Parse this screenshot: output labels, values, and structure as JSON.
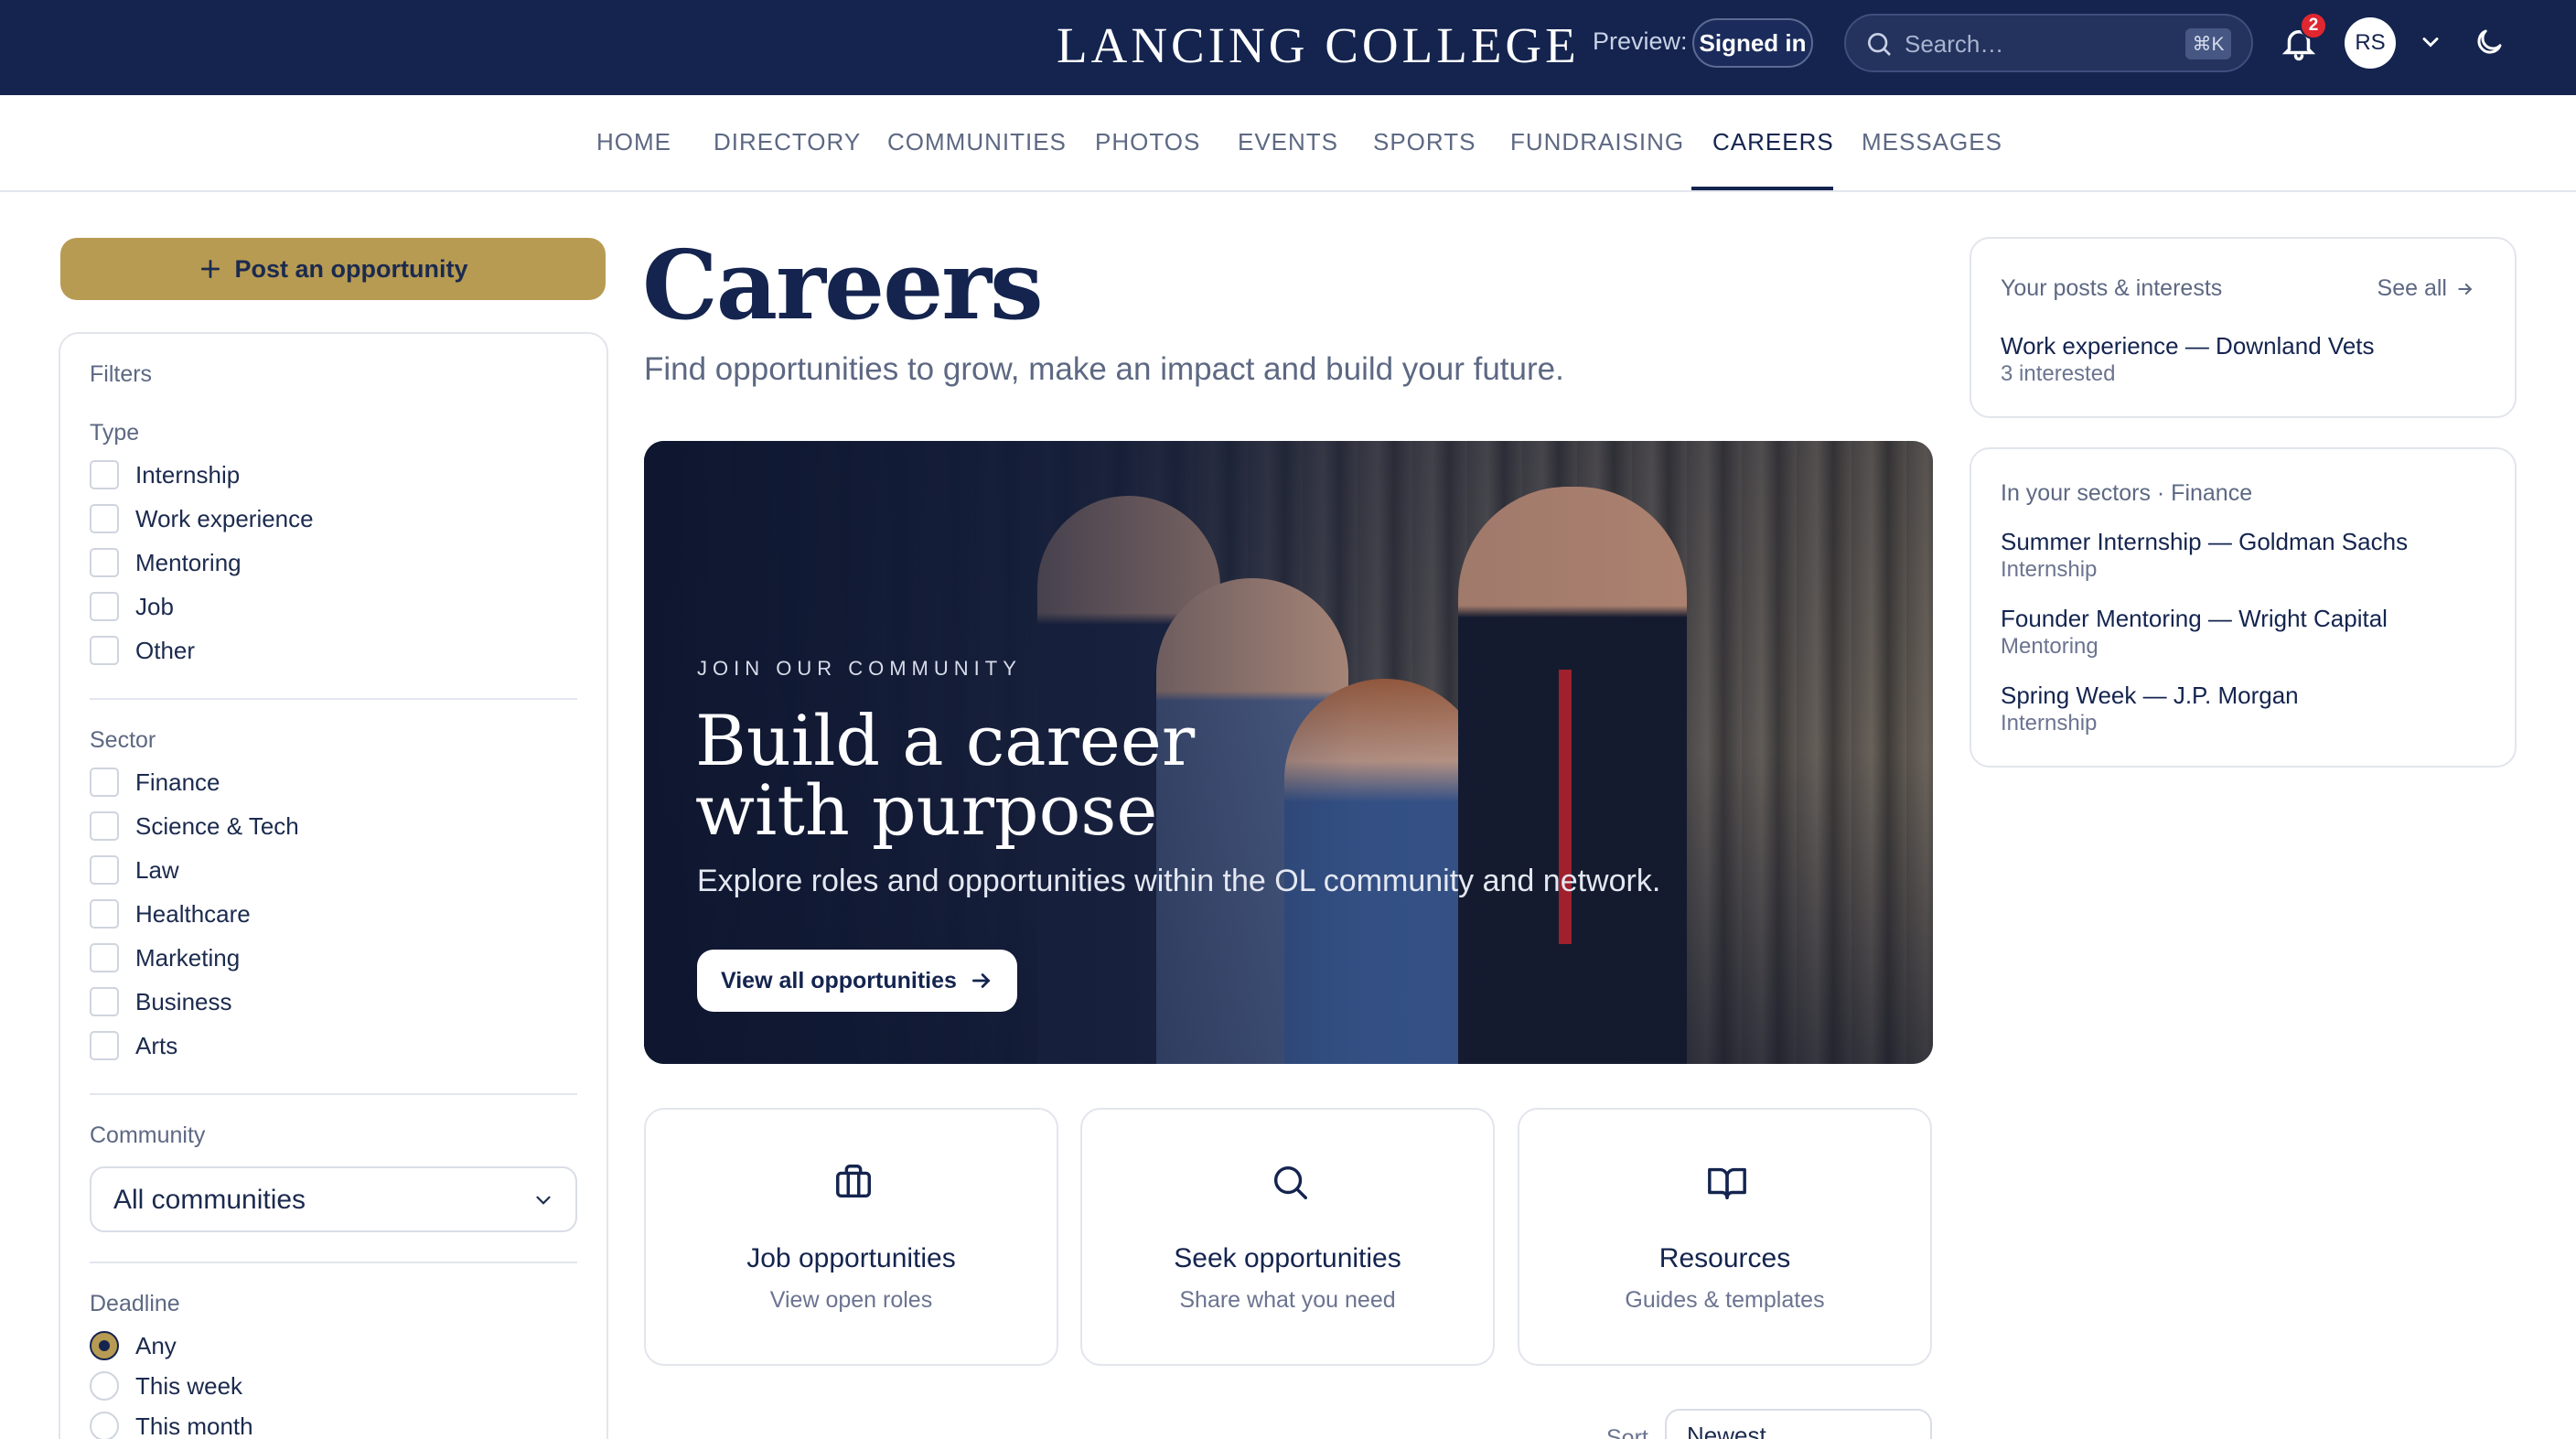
{
  "header": {
    "brand": "LANCING COLLEGE",
    "preview_label": "Preview:",
    "preview_state": "Signed in",
    "search_placeholder": "Search…",
    "search_shortcut": "⌘K",
    "notifications_count": "2",
    "user_initials": "RS",
    "colors": {
      "bar": "#14244f",
      "accent": "#b89b52"
    }
  },
  "nav": {
    "items": [
      "HOME",
      "DIRECTORY",
      "COMMUNITIES",
      "PHOTOS",
      "EVENTS",
      "SPORTS",
      "FUNDRAISING",
      "CAREERS",
      "MESSAGES"
    ],
    "active": "CAREERS"
  },
  "sidebar": {
    "post_button": "Post an opportunity",
    "filters_title": "Filters",
    "type_title": "Type",
    "types": [
      "Internship",
      "Work experience",
      "Mentoring",
      "Job",
      "Other"
    ],
    "sector_title": "Sector",
    "sectors": [
      "Finance",
      "Science & Tech",
      "Law",
      "Healthcare",
      "Marketing",
      "Business",
      "Arts"
    ],
    "community_title": "Community",
    "community_value": "All communities",
    "deadline_title": "Deadline",
    "deadlines": [
      "Any",
      "This week",
      "This month"
    ],
    "deadline_selected": "Any"
  },
  "main": {
    "title": "Careers",
    "subtitle": "Find opportunities to grow, make an impact and build your future.",
    "hero": {
      "kicker": "JOIN OUR COMMUNITY",
      "title_line1": "Build a career",
      "title_line2": "with purpose",
      "description": "Explore roles and opportunities within the OL community and network.",
      "button": "View all opportunities"
    },
    "cards": [
      {
        "title": "Job opportunities",
        "subtitle": "View open roles",
        "icon": "briefcase-icon"
      },
      {
        "title": "Seek opportunities",
        "subtitle": "Share what you need",
        "icon": "search-icon"
      },
      {
        "title": "Resources",
        "subtitle": "Guides & templates",
        "icon": "book-icon"
      }
    ],
    "sort_label": "Sort",
    "sort_value": "Newest"
  },
  "right": {
    "posts_title": "Your posts & interests",
    "see_all": "See all",
    "posts": [
      {
        "title": "Work experience — Downland Vets",
        "meta": "3 interested"
      }
    ],
    "sectors_title": "In your sectors · Finance",
    "sector_items": [
      {
        "title": "Summer Internship — Goldman Sachs",
        "meta": "Internship"
      },
      {
        "title": "Founder Mentoring — Wright Capital",
        "meta": "Mentoring"
      },
      {
        "title": "Spring Week — J.P. Morgan",
        "meta": "Internship"
      }
    ]
  }
}
